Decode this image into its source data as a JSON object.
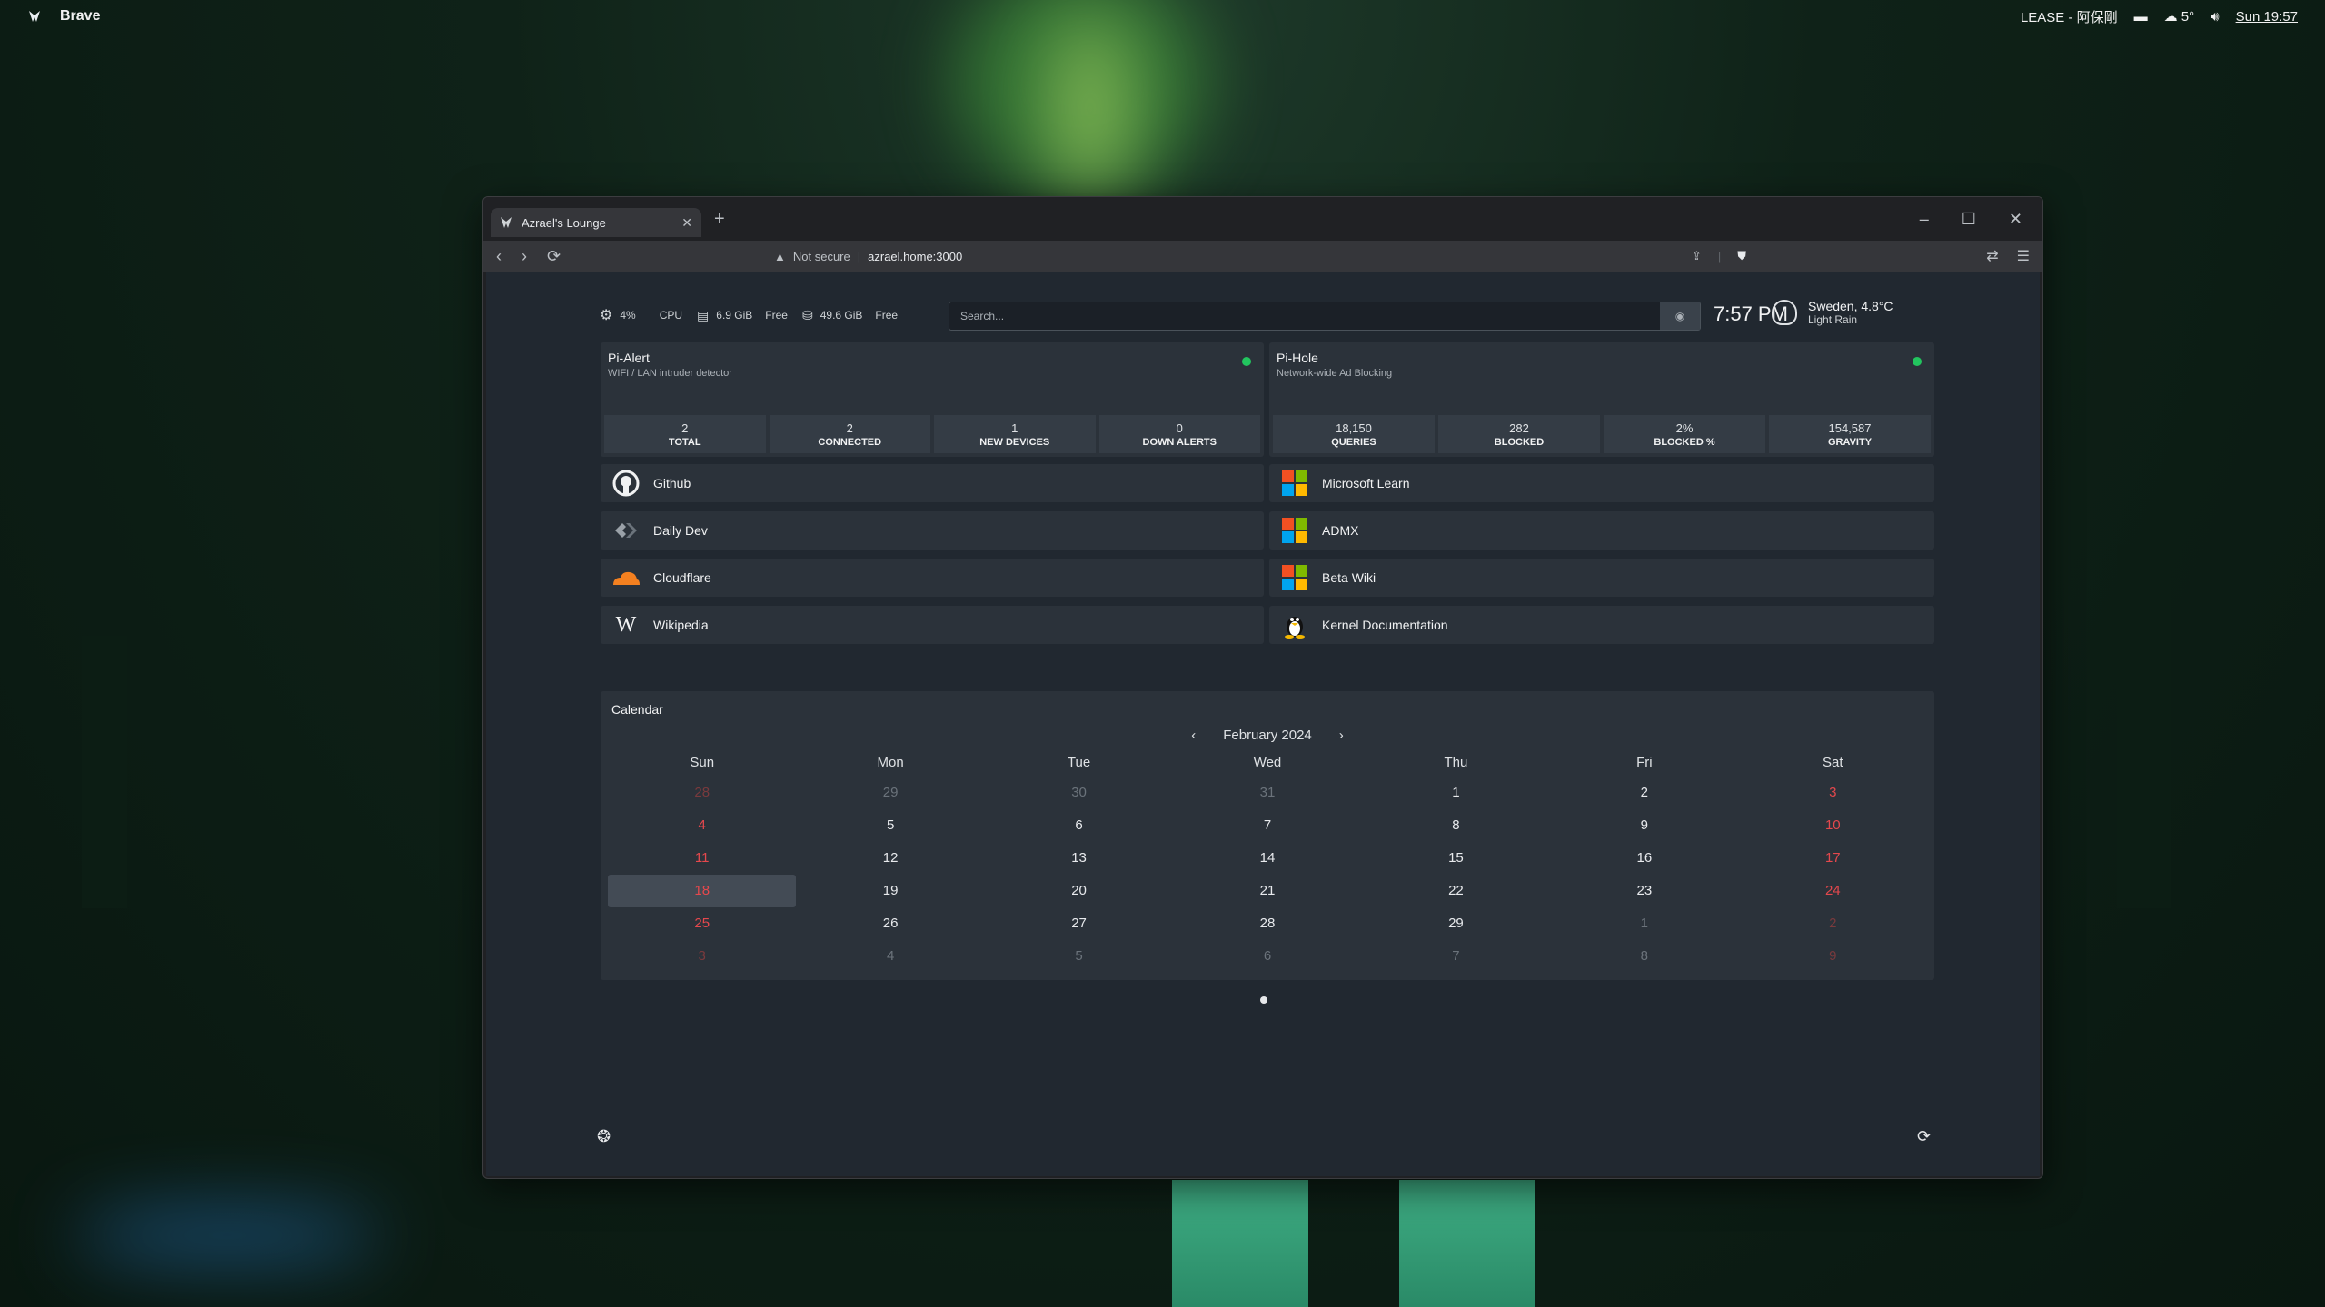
{
  "desktop": {
    "app_name": "Brave",
    "tray": {
      "keyboard": "LEASE - 阿保剛",
      "weather": "5°",
      "clock": "Sun 19:57"
    }
  },
  "browser": {
    "tab_title": "Azrael's Lounge",
    "security_label": "Not secure",
    "url": "azrael.home:3000"
  },
  "stats": {
    "cpu_value": "4%",
    "cpu_label": "CPU",
    "cpu_fraction": 0.04,
    "ram_value": "6.9 GiB",
    "ram_label": "Free",
    "disk_value": "49.6 GiB",
    "disk_label": "Free"
  },
  "search": {
    "placeholder": "Search..."
  },
  "clock": {
    "time": "7:57 PM"
  },
  "weather": {
    "location": "Sweden, 4.8°C",
    "condition": "Light Rain"
  },
  "services": [
    {
      "title": "Pi-Alert",
      "subtitle": "WIFI / LAN intruder detector",
      "status_color": "#22c55e",
      "metrics": [
        {
          "value": "2",
          "label": "TOTAL"
        },
        {
          "value": "2",
          "label": "CONNECTED"
        },
        {
          "value": "1",
          "label": "NEW DEVICES"
        },
        {
          "value": "0",
          "label": "DOWN ALERTS"
        }
      ]
    },
    {
      "title": "Pi-Hole",
      "subtitle": "Network-wide Ad Blocking",
      "status_color": "#22c55e",
      "metrics": [
        {
          "value": "18,150",
          "label": "QUERIES"
        },
        {
          "value": "282",
          "label": "BLOCKED"
        },
        {
          "value": "2%",
          "label": "BLOCKED %"
        },
        {
          "value": "154,587",
          "label": "GRAVITY"
        }
      ]
    }
  ],
  "bookmarks": [
    {
      "label": "Github",
      "icon": "github-icon"
    },
    {
      "label": "Microsoft Learn",
      "icon": "microsoft-icon"
    },
    {
      "label": "Daily Dev",
      "icon": "dailydev-icon"
    },
    {
      "label": "ADMX",
      "icon": "microsoft-icon"
    },
    {
      "label": "Cloudflare",
      "icon": "cloudflare-icon"
    },
    {
      "label": "Beta Wiki",
      "icon": "microsoft-icon"
    },
    {
      "label": "Wikipedia",
      "icon": "wikipedia-icon"
    },
    {
      "label": "Kernel Documentation",
      "icon": "linux-tux-icon"
    }
  ],
  "calendar": {
    "title": "Calendar",
    "month_label": "February 2024",
    "prev": "‹",
    "next": "›",
    "weekdays": [
      "Sun",
      "Mon",
      "Tue",
      "Wed",
      "Thu",
      "Fri",
      "Sat"
    ],
    "days": [
      "28",
      "29",
      "30",
      "31",
      "1",
      "2",
      "3",
      "4",
      "5",
      "6",
      "7",
      "8",
      "9",
      "10",
      "11",
      "12",
      "13",
      "14",
      "15",
      "16",
      "17",
      "18",
      "19",
      "20",
      "21",
      "22",
      "23",
      "24",
      "25",
      "26",
      "27",
      "28",
      "29",
      "1",
      "2",
      "3",
      "4",
      "5",
      "6",
      "7",
      "8",
      "9"
    ],
    "today": "18"
  },
  "colors": {
    "accent_green": "#22c55e",
    "weekend_red": "#e5484d",
    "page_bg": "#212830"
  }
}
